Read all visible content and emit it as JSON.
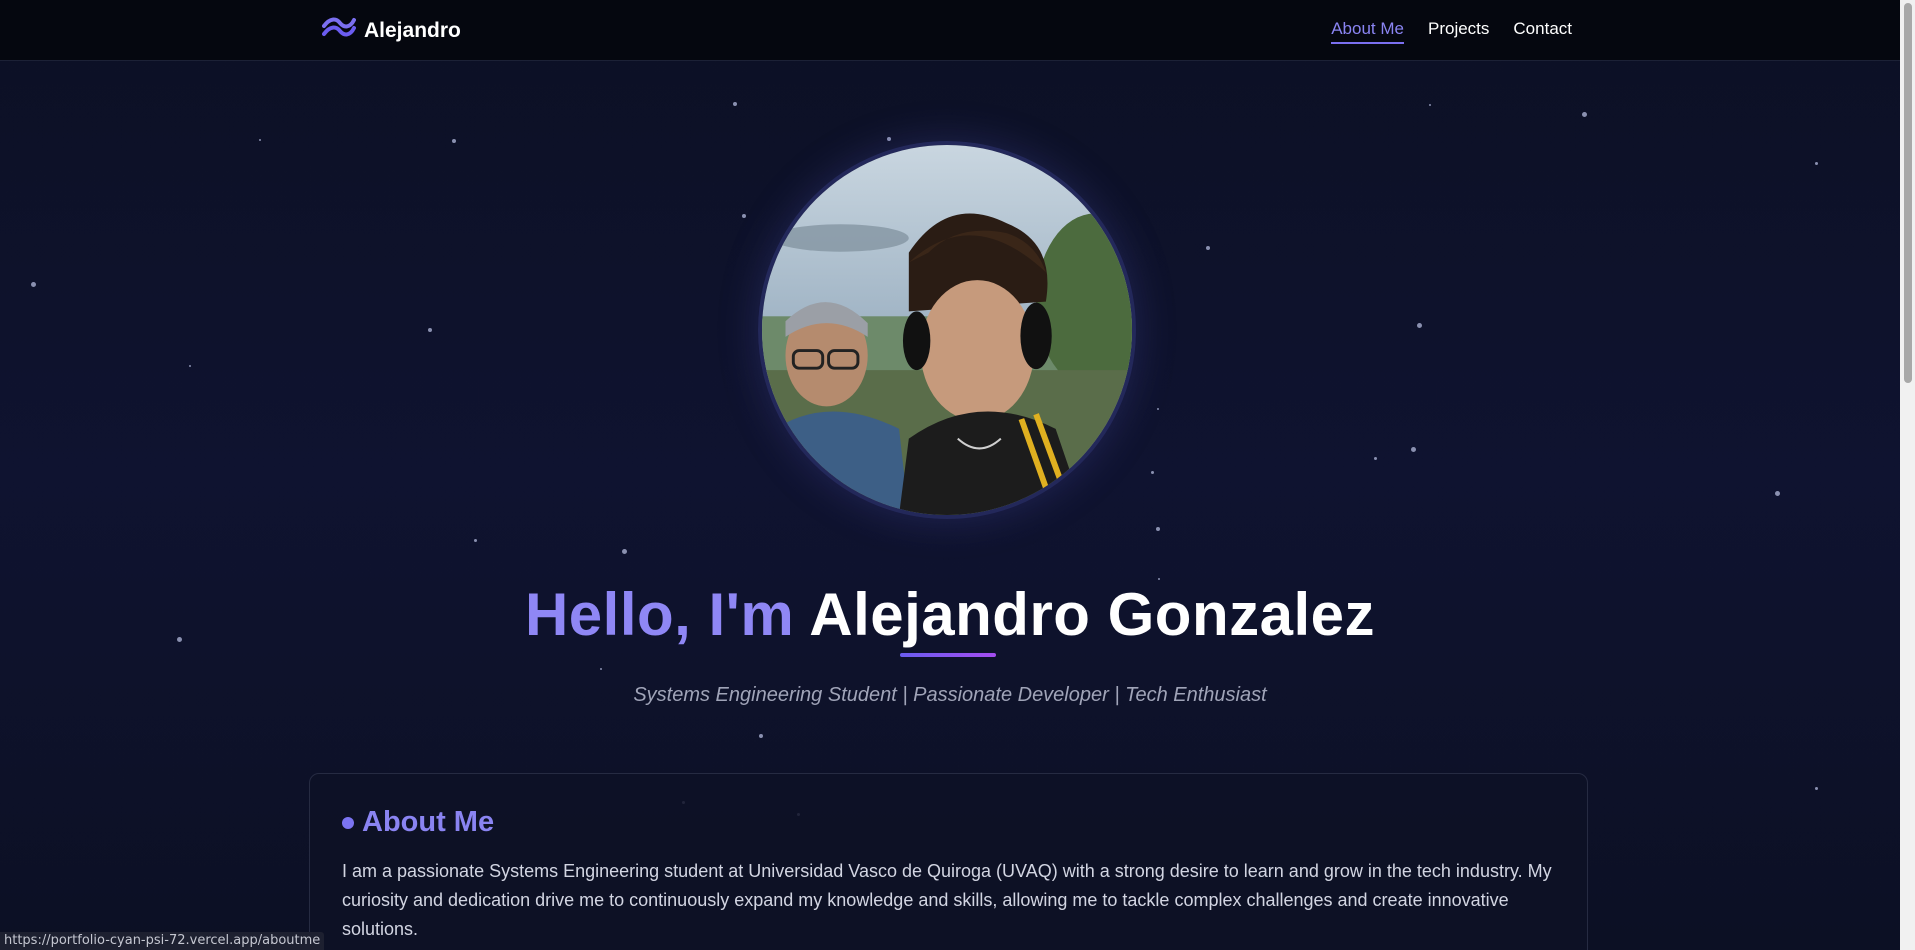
{
  "nav": {
    "brand_name": "Alejandro",
    "brand_icon": "wave-icon",
    "links": [
      {
        "label": "About Me",
        "active": true
      },
      {
        "label": "Projects",
        "active": false
      },
      {
        "label": "Contact",
        "active": false
      }
    ]
  },
  "hero": {
    "greeting": "Hello, I'm",
    "name": "Alejandro Gonzalez",
    "subtitle": "Systems Engineering Student | Passionate Developer | Tech Enthusiast"
  },
  "about": {
    "title": "About Me",
    "text": "I am a passionate Systems Engineering student at Universidad Vasco de Quiroga (UVAQ) with a strong desire to learn and grow in the tech industry. My curiosity and dedication drive me to continuously expand my knowledge and skills, allowing me to tackle complex challenges and create innovative solutions."
  },
  "status_bar": {
    "url": "https://portfolio-cyan-psi-72.vercel.app/aboutme"
  },
  "colors": {
    "accent": "#8a84f2",
    "background": "#0f1330",
    "navbar": "#05070f"
  }
}
